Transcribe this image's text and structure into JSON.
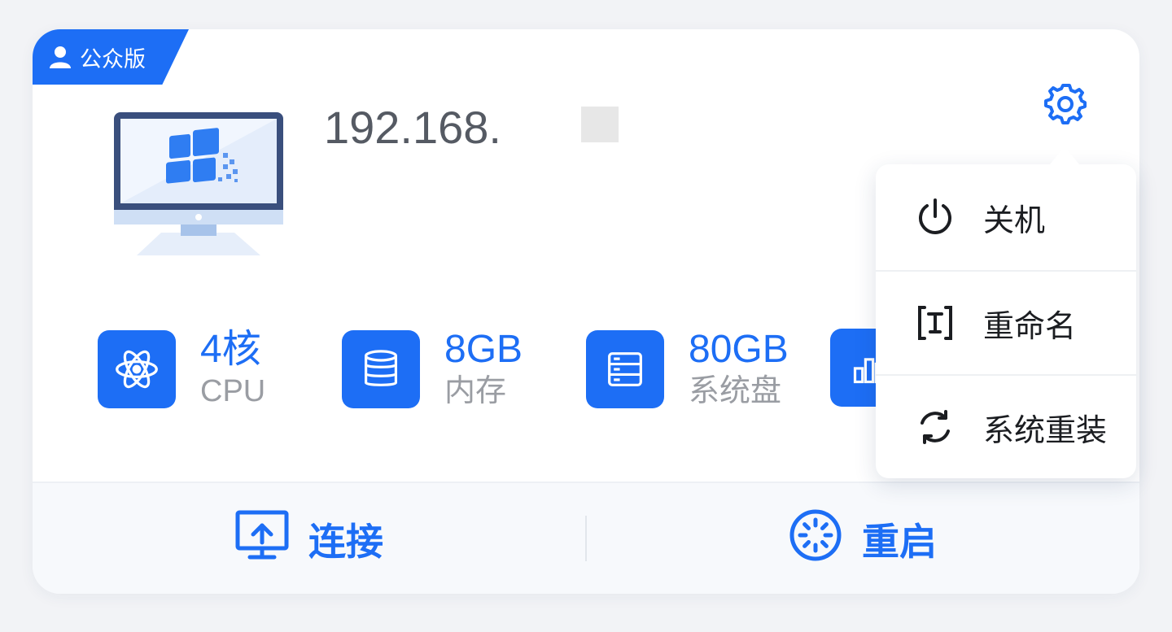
{
  "badge": {
    "label": "公众版",
    "icon": "user-icon"
  },
  "machine": {
    "ip": "192.168.",
    "image": "windows-monitor"
  },
  "specs": [
    {
      "value": "4核",
      "label": "CPU",
      "icon": "atom-icon"
    },
    {
      "value": "8GB",
      "label": "内存",
      "icon": "database-icon"
    },
    {
      "value": "80GB",
      "label": "系统盘",
      "icon": "server-icon"
    },
    {
      "value": "",
      "label": "",
      "icon": "bar-chart-icon"
    }
  ],
  "menu": {
    "items": [
      {
        "label": "关机",
        "icon": "power-icon"
      },
      {
        "label": "重命名",
        "icon": "rename-icon"
      },
      {
        "label": "系统重装",
        "icon": "refresh-icon"
      }
    ]
  },
  "footer": {
    "connect_label": "连接",
    "restart_label": "重启"
  },
  "colors": {
    "accent": "#1d6ef5",
    "muted": "#9a9da3"
  }
}
